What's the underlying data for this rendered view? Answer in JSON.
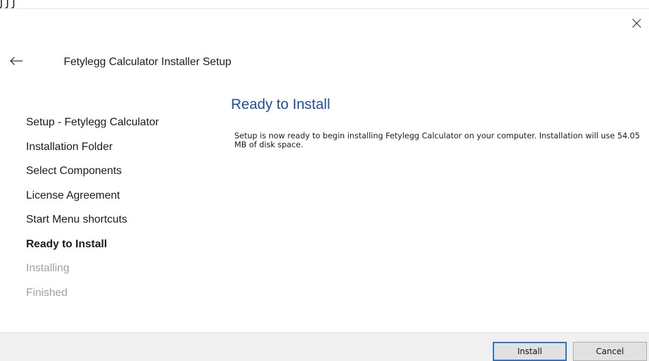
{
  "top_clipped_text": "ʃ ʃ ʃ",
  "window": {
    "title": "Fetylegg Calculator Installer Setup"
  },
  "steps": [
    {
      "label": "Setup - Fetylegg Calculator",
      "state": "done"
    },
    {
      "label": "Installation Folder",
      "state": "done"
    },
    {
      "label": "Select Components",
      "state": "done"
    },
    {
      "label": "License Agreement",
      "state": "done"
    },
    {
      "label": "Start Menu shortcuts",
      "state": "done"
    },
    {
      "label": "Ready to Install",
      "state": "current"
    },
    {
      "label": "Installing",
      "state": "pending"
    },
    {
      "label": "Finished",
      "state": "pending"
    }
  ],
  "page": {
    "heading": "Ready to Install",
    "text": "Setup is now ready to begin installing Fetylegg Calculator on your computer. Installation will use 54.05 MB of disk space."
  },
  "footer": {
    "install_label": "Install",
    "cancel_label": "Cancel"
  },
  "colors": {
    "heading": "#1f4fa3",
    "pending_step": "#a0a0a0",
    "footer_bg": "#f0f0f0",
    "default_button_border": "#2a73d4"
  },
  "icons": {
    "close": "close-icon",
    "back": "back-arrow-icon"
  }
}
